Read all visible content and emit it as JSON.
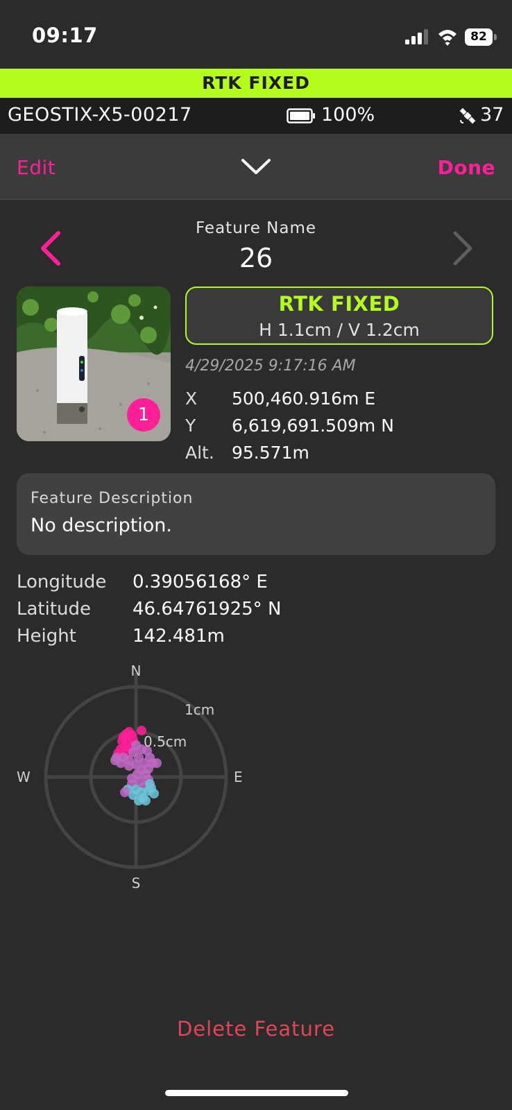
{
  "status_bar": {
    "time": "09:17",
    "battery": "82"
  },
  "fix_banner": {
    "label": "RTK FIXED",
    "color": "#b4fc1c"
  },
  "device": {
    "name": "GEOSTIX-X5-00217",
    "battery": "100%",
    "satellites": "37"
  },
  "nav": {
    "edit": "Edit",
    "done": "Done",
    "accent_color": "#ff1f99"
  },
  "feature": {
    "name_label": "Feature Name",
    "name": "26",
    "photo_count": "1",
    "fix_status": "RTK FIXED",
    "accuracy": "H 1.1cm / V 1.2cm",
    "timestamp": "4/29/2025 9:17:16 AM",
    "coords": [
      {
        "label": "X",
        "value": "500,460.916m E"
      },
      {
        "label": "Y",
        "value": "6,619,691.509m N"
      },
      {
        "label": "Alt.",
        "value": "95.571m"
      }
    ],
    "description_label": "Feature Description",
    "description": "No description.",
    "geo": [
      {
        "label": "Longitude",
        "value": "0.39056168° E"
      },
      {
        "label": "Latitude",
        "value": "46.64761925° N"
      },
      {
        "label": "Height",
        "value": "142.481m"
      }
    ]
  },
  "scatter": {
    "north": "N",
    "south": "S",
    "east": "E",
    "west": "W",
    "outer_ring": "1cm",
    "inner_ring": "0.5cm",
    "colors": {
      "early": "#ff1f99",
      "mid": "#c06ac4",
      "late": "#6cc6da"
    }
  },
  "delete_label": "Delete Feature"
}
